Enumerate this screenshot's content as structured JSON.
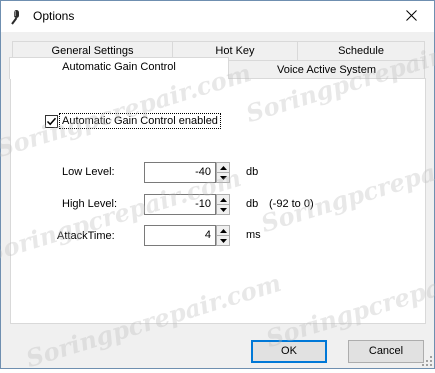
{
  "window": {
    "title": "Options",
    "icon": "microphone-icon",
    "close_icon": "close-icon"
  },
  "tabs": {
    "row1": [
      "General Settings",
      "Hot Key",
      "Schedule"
    ],
    "row2": [
      "Automatic Gain Control",
      "Voice Active System"
    ],
    "active": "Automatic Gain Control"
  },
  "agc": {
    "enabled_label": "Automatic Gain Control  enabled",
    "enabled": true,
    "fields": [
      {
        "label": "Low Level:",
        "value": "-40",
        "unit": "db",
        "note": ""
      },
      {
        "label": "High Level:",
        "value": "-10",
        "unit": "db",
        "note": "(-92 to 0)"
      },
      {
        "label": "AttackTime:",
        "value": "4",
        "unit": "ms",
        "note": ""
      }
    ]
  },
  "buttons": {
    "ok": "OK",
    "cancel": "Cancel"
  },
  "watermark": "Soringpcrepair.com",
  "colors": {
    "accent": "#0078d7",
    "panel": "#ffffff",
    "frame": "#f0f0f0"
  }
}
